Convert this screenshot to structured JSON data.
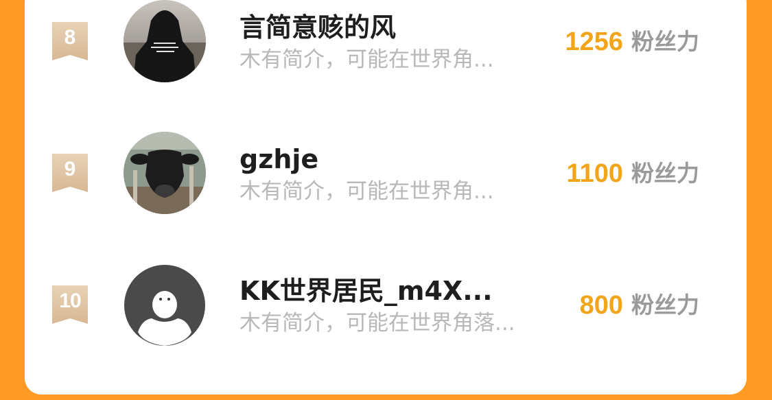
{
  "rows": [
    {
      "rank": "8",
      "name": "言简意赅的风",
      "bio": "木有简介，可能在世界角...",
      "score": "1256",
      "unit": "粉丝力",
      "avatar": "hooded-person-photo"
    },
    {
      "rank": "9",
      "name": "gzhje",
      "bio": "木有简介，可能在世界角...",
      "score": "1100",
      "unit": "粉丝力",
      "avatar": "calf-photo"
    },
    {
      "rank": "10",
      "name": "KK世界居民_m4X...",
      "bio": "木有简介，可能在世界角落...",
      "score": "800",
      "unit": "粉丝力",
      "avatar": "default-avatar"
    }
  ],
  "colors": {
    "background": "#ff9a24",
    "score": "#f2a51a",
    "badge": "#dcc0a0",
    "name": "#1e1e1e",
    "bio": "#b8b8b8",
    "unit": "#9a9a9a"
  }
}
